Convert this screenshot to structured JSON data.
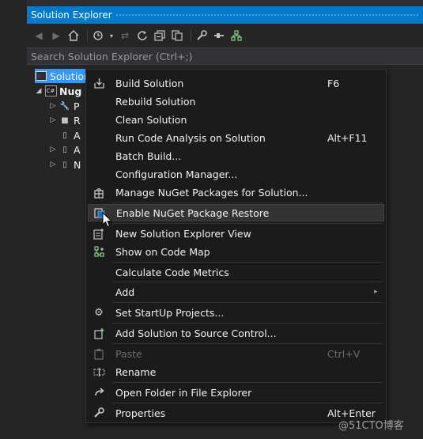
{
  "window": {
    "title": "Solution Explorer"
  },
  "toolbar": {
    "icons": [
      "back-icon",
      "forward-icon",
      "home-icon",
      "history-icon",
      "dropdown-icon",
      "sync-icon",
      "refresh-icon",
      "collapse-all-icon",
      "show-all-files-icon",
      "properties-icon",
      "pending-changes-icon",
      "code-map-icon"
    ]
  },
  "search": {
    "placeholder": "Search Solution Explorer (Ctrl+;)"
  },
  "tree": {
    "solution_label": "Solution",
    "project_label": "Nug",
    "children": [
      "P",
      "R",
      "A",
      "A",
      "N"
    ]
  },
  "context_menu": {
    "items": [
      {
        "label": "Build Solution",
        "shortcut": "F6",
        "icon": "build-icon"
      },
      {
        "label": "Rebuild Solution",
        "shortcut": ""
      },
      {
        "label": "Clean Solution",
        "shortcut": ""
      },
      {
        "label": "Run Code Analysis on Solution",
        "shortcut": "Alt+F11"
      },
      {
        "label": "Batch Build...",
        "shortcut": ""
      },
      {
        "label": "Configuration Manager...",
        "shortcut": ""
      },
      {
        "label": "Manage NuGet Packages for Solution...",
        "shortcut": "",
        "icon": "nuget-icon"
      },
      {
        "label": "Enable NuGet Package Restore",
        "shortcut": "",
        "icon": "package-restore-icon",
        "state": "hover"
      },
      {
        "label": "New Solution Explorer View",
        "shortcut": "",
        "icon": "new-view-icon"
      },
      {
        "label": "Show on Code Map",
        "shortcut": "",
        "icon": "code-map-icon"
      },
      {
        "label": "Calculate Code Metrics",
        "shortcut": ""
      },
      {
        "label": "Add",
        "shortcut": "",
        "submenu": "▸"
      },
      {
        "label": "Set StartUp Projects...",
        "shortcut": "",
        "icon": "gear-icon"
      },
      {
        "label": "Add Solution to Source Control...",
        "shortcut": "",
        "icon": "source-control-icon"
      },
      {
        "label": "Paste",
        "shortcut": "Ctrl+V",
        "icon": "paste-icon",
        "state": "disabled"
      },
      {
        "label": "Rename",
        "shortcut": "",
        "icon": "rename-icon"
      },
      {
        "label": "Open Folder in File Explorer",
        "shortcut": "",
        "icon": "open-folder-icon"
      },
      {
        "label": "Properties",
        "shortcut": "Alt+Enter",
        "icon": "wrench-icon"
      }
    ]
  },
  "watermark": "@51CTO博客",
  "colors": {
    "accent": "#007acc",
    "selection": "#3399ff",
    "menu_bg": "#1b1b1c",
    "panel_bg": "#252526"
  }
}
